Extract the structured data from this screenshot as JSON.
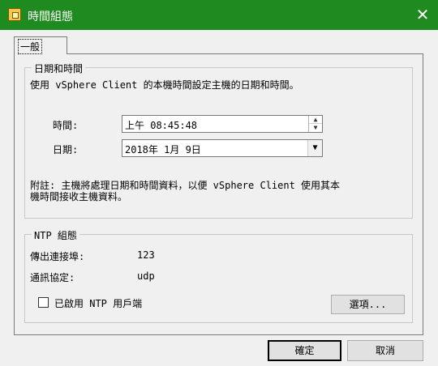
{
  "window": {
    "title": "時間組態",
    "icon": "clock-config-icon",
    "close_icon": "close-icon"
  },
  "tabs": [
    {
      "label": "一般",
      "selected": true
    }
  ],
  "datetime_group": {
    "legend": "日期和時間",
    "description": "使用 vSphere Client 的本機時間設定主機的日期和時間。",
    "time_label": "時間:",
    "time_value": "上午 08:45:48",
    "date_label": "日期:",
    "date_value": "2018年 1月 9日",
    "note_line1": "附註: 主機將處理日期和時間資料，以便 vSphere Client 使用其本",
    "note_line2": "機時間接收主機資料。"
  },
  "ntp_group": {
    "legend": "NTP 組態",
    "port_label": "傳出連接埠:",
    "port_value": "123",
    "protocol_label": "通訊協定:",
    "protocol_value": "udp",
    "enable_label": "已啟用 NTP 用戶端",
    "enable_checked": false,
    "options_button": "選項..."
  },
  "footer": {
    "ok_button": "確定",
    "cancel_button": "取消"
  },
  "colors": {
    "titlebar": "#1f8a1f",
    "background": "#f0f0f0"
  }
}
